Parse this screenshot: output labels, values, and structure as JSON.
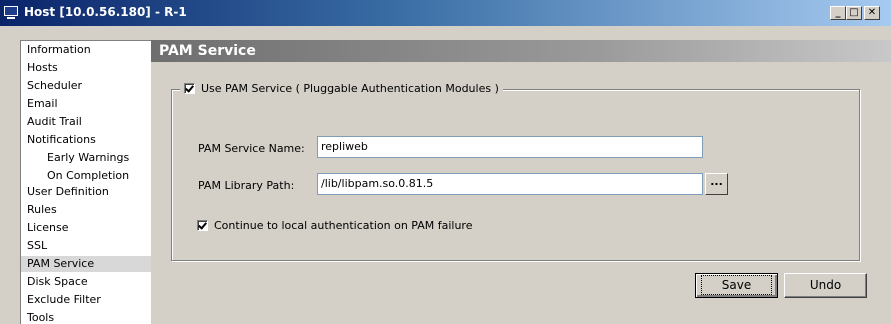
{
  "window": {
    "title": "Host [10.0.56.180] - R-1",
    "controls": {
      "minimize": "_",
      "maximize": "□",
      "close": "✕"
    }
  },
  "sidebar": {
    "items": [
      {
        "label": "Information",
        "sub": false,
        "selected": false
      },
      {
        "label": "Hosts",
        "sub": false,
        "selected": false
      },
      {
        "label": "Scheduler",
        "sub": false,
        "selected": false
      },
      {
        "label": "Email",
        "sub": false,
        "selected": false
      },
      {
        "label": "Audit Trail",
        "sub": false,
        "selected": false
      },
      {
        "label": "Notifications",
        "sub": false,
        "selected": false
      },
      {
        "label": "Early Warnings",
        "sub": true,
        "selected": false
      },
      {
        "label": "On Completion",
        "sub": true,
        "selected": false
      },
      {
        "label": "User Definition",
        "sub": false,
        "selected": false
      },
      {
        "label": "Rules",
        "sub": false,
        "selected": false
      },
      {
        "label": "License",
        "sub": false,
        "selected": false
      },
      {
        "label": "SSL",
        "sub": false,
        "selected": false
      },
      {
        "label": "PAM Service",
        "sub": false,
        "selected": true
      },
      {
        "label": "Disk Space",
        "sub": false,
        "selected": false
      },
      {
        "label": "Exclude Filter",
        "sub": false,
        "selected": false
      },
      {
        "label": "Tools",
        "sub": false,
        "selected": false
      }
    ]
  },
  "panel": {
    "title": "PAM Service",
    "use_pam": {
      "label": "Use PAM Service ( Pluggable Authentication Modules )",
      "checked": true
    },
    "service_name": {
      "label": "PAM Service Name:",
      "value": "repliweb"
    },
    "library_path": {
      "label": "PAM Library Path:",
      "value": "/lib/libpam.so.0.81.5",
      "browse_label": "..."
    },
    "continue_local": {
      "label": "Continue to local authentication on PAM failure",
      "checked": true
    }
  },
  "buttons": {
    "save": "Save",
    "undo": "Undo"
  }
}
